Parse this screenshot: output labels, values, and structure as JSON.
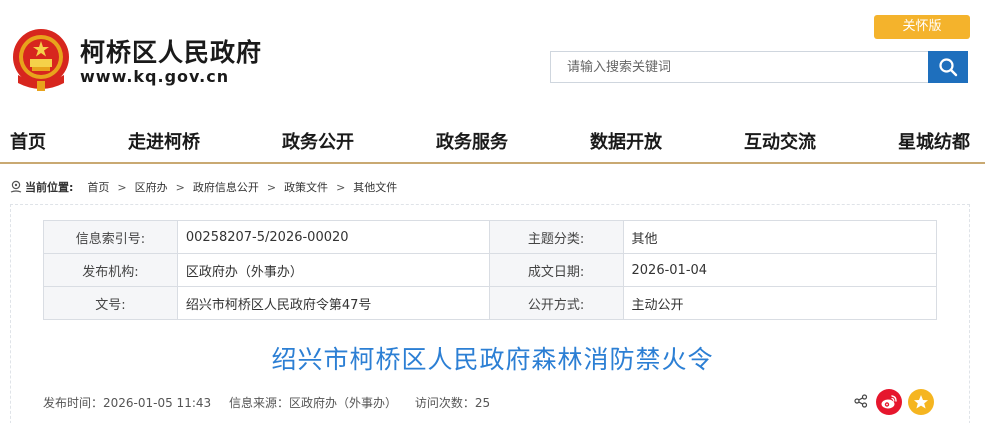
{
  "header": {
    "site_name": "柯桥区人民政府",
    "site_url": "www.kq.gov.cn",
    "care_button": "关怀版",
    "emblem_icon": "national-emblem-icon"
  },
  "search": {
    "placeholder": "请输入搜索关键词",
    "value": "",
    "button_icon": "search-icon"
  },
  "nav": {
    "items": [
      {
        "label": "首页"
      },
      {
        "label": "走进柯桥"
      },
      {
        "label": "政务公开"
      },
      {
        "label": "政务服务"
      },
      {
        "label": "数据开放"
      },
      {
        "label": "互动交流"
      },
      {
        "label": "星城纺都"
      }
    ]
  },
  "breadcrumb": {
    "label": "当前位置:",
    "items": [
      "首页",
      "区府办",
      "政府信息公开",
      "政策文件",
      "其他文件"
    ],
    "separator": ">"
  },
  "info_table": {
    "rows": [
      {
        "k1": "信息索引号:",
        "v1": "00258207-5/2026-00020",
        "k2": "主题分类:",
        "v2": "其他"
      },
      {
        "k1": "发布机构:",
        "v1": "区政府办（外事办）",
        "k2": "成文日期:",
        "v2": "2026-01-04"
      },
      {
        "k1": "文号:",
        "v1": "绍兴市柯桥区人民政府令第47号",
        "k2": "公开方式:",
        "v2": "主动公开"
      }
    ]
  },
  "article": {
    "title": "绍兴市柯桥区人民政府森林消防禁火令",
    "publish_time": "发布时间：2026-01-05 11:43",
    "source": "信息来源：区政府办（外事办）",
    "visits": "访问次数：25"
  },
  "share": {
    "icons": [
      "share-icon",
      "weibo-icon",
      "qzone-icon"
    ]
  },
  "colors": {
    "accent_blue": "#1e6fbd",
    "title_blue": "#2c7fd4",
    "care_orange": "#f4b32c",
    "nav_underline": "#c9a972",
    "weibo_red": "#e6162d",
    "qzone_yellow": "#f5b520"
  }
}
